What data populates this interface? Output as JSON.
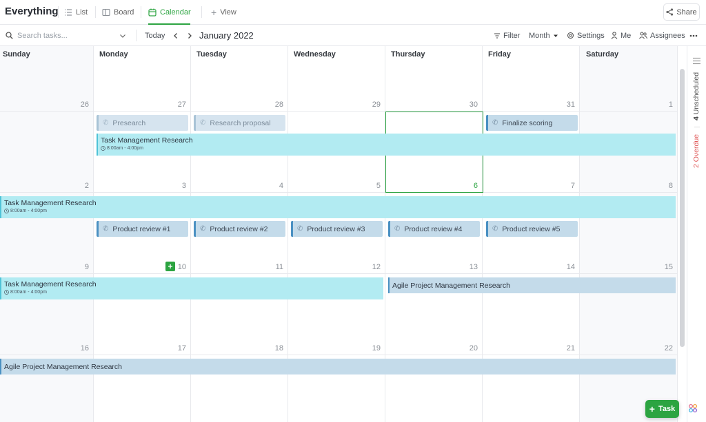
{
  "header": {
    "title": "Everything",
    "tabs": [
      {
        "label": "List",
        "icon": "list-icon"
      },
      {
        "label": "Board",
        "icon": "board-icon"
      },
      {
        "label": "Calendar",
        "icon": "calendar-icon",
        "active": true
      },
      {
        "label": "View",
        "icon": "plus-icon"
      }
    ],
    "share_label": "Share"
  },
  "toolbar": {
    "search_placeholder": "Search tasks...",
    "today_label": "Today",
    "month_label": "January 2022",
    "filter_label": "Filter",
    "view_mode_label": "Month",
    "settings_label": "Settings",
    "me_label": "Me",
    "assignees_label": "Assignees"
  },
  "calendar": {
    "weekdays": [
      "Sunday",
      "Monday",
      "Tuesday",
      "Wednesday",
      "Thursday",
      "Friday",
      "Saturday"
    ],
    "weeks": [
      [
        "26",
        "27",
        "28",
        "29",
        "30",
        "31",
        "1"
      ],
      [
        "2",
        "3",
        "4",
        "5",
        "6",
        "7",
        "8"
      ],
      [
        "9",
        "10",
        "11",
        "12",
        "13",
        "14",
        "15"
      ],
      [
        "16",
        "17",
        "18",
        "19",
        "20",
        "21",
        "22"
      ]
    ],
    "today": "6"
  },
  "tasks": {
    "presearch": "Presearch",
    "research_proposal": "Research proposal",
    "finalize_scoring": "Finalize scoring",
    "tmr_name": "Task Management Research",
    "tmr_time": "8:00am - 4:00pm",
    "product_reviews": [
      "Product review #1",
      "Product review #2",
      "Product review #3",
      "Product review #4",
      "Product review #5"
    ],
    "apmr_name": "Agile Project Management Research"
  },
  "side_panel": {
    "unscheduled_count": "4",
    "unscheduled_label": "Unscheduled",
    "overdue_count": "2",
    "overdue_label": "Overdue"
  },
  "fab": {
    "label": "Task"
  },
  "colors": {
    "accent": "#2ca441",
    "event_cyan": "#b2ebf2",
    "event_blue": "#c4dbea",
    "overdue": "#e05a5a"
  }
}
